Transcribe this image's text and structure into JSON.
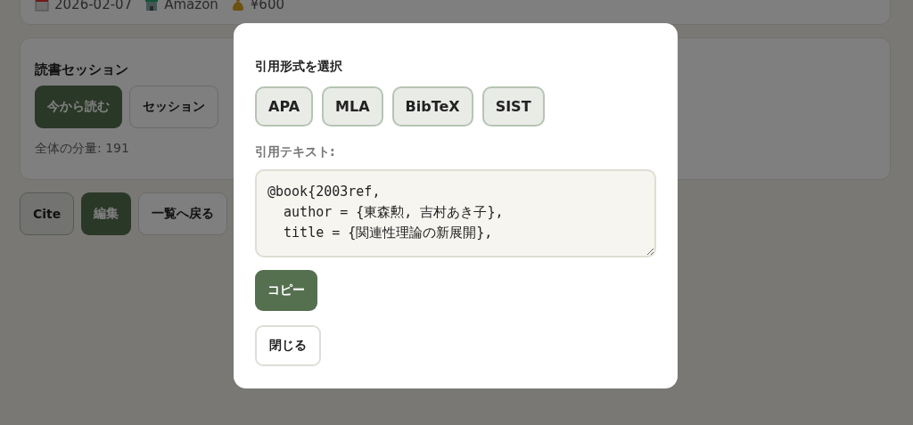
{
  "book_meta": {
    "date": "2026-02-07",
    "store": "Amazon",
    "price": "¥600"
  },
  "reading_session": {
    "title": "読書セッション",
    "buttons": [
      {
        "label": "今から読む",
        "kind": "primary"
      },
      {
        "label": "セッション",
        "kind": "secondary"
      }
    ],
    "total_pages": "全体の分量: 191"
  },
  "actions": [
    {
      "label": "Cite",
      "kind": "muted"
    },
    {
      "label": "編集",
      "kind": "primary"
    },
    {
      "label": "一覧へ戻る",
      "kind": "secondary"
    }
  ],
  "cite_dialog": {
    "format_heading": "引用形式を選択",
    "formats": [
      "APA",
      "MLA",
      "BibTeX",
      "SIST"
    ],
    "text_label": "引用テキスト:",
    "citation_text": "@book{2003ref,\n  author = {東森勲, 吉村あき子},\n  title = {関連性理論の新展開},",
    "copy_button": "コピー",
    "close_button": "閉じる"
  }
}
